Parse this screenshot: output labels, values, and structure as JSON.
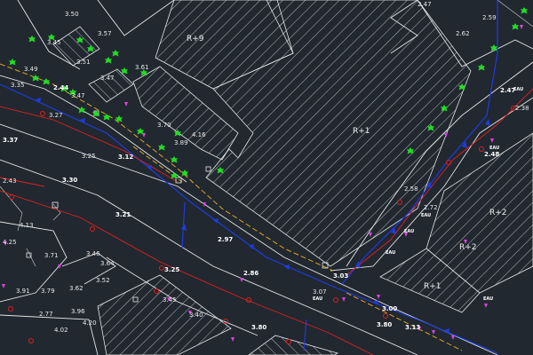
{
  "colors": {
    "background": "#212830",
    "lines": "#e6e6e6",
    "sewer": "#1e3ce0",
    "gas": "#e02020",
    "electric": "#f0b020",
    "tree": "#22dd22",
    "marker": "#e040e0"
  },
  "zones": {
    "r9": "R+9",
    "r1_a": "R+1",
    "r2_a": "R+2",
    "r2_b": "R+2",
    "r1_b": "R+1"
  },
  "eau_labels": [
    "EAU",
    "EAU",
    "EAU",
    "EAU",
    "EAU",
    "EAU",
    "EAU"
  ],
  "elevations": {
    "e350": "3.50",
    "e345": "3.45",
    "e351": "3.51",
    "e357": "3.57",
    "e361": "3.61",
    "e349": "3.49",
    "e335": "3.35",
    "e344": "2.44",
    "e347": "3.47",
    "e347b": "3.47",
    "e327": "3.27",
    "e337": "3.37",
    "e325": "3.25",
    "e312": "3.12",
    "e370": "3.70",
    "e389": "3.89",
    "e416": "4.16",
    "e330": "3.30",
    "e243": "2.43",
    "e321": "3.21",
    "e425": "4.25",
    "e413": "4.13",
    "e297": "2.97",
    "e371": "3.71",
    "e346": "3.46",
    "e364": "3.64",
    "e325b": "3.25",
    "e386": "2.86",
    "e391": "3.91",
    "e379": "3.79",
    "e362": "3.62",
    "e352": "3.52",
    "e345b": "3.45",
    "e340": "3.40",
    "e277": "2.77",
    "e396": "3.96",
    "e420": "4.20",
    "e402": "4.02",
    "e380": "3.80",
    "e307": "3.07",
    "e303": "3.03",
    "e300": "3.00",
    "e380b": "3.80",
    "e313": "3.13",
    "e247": "2.47",
    "e259": "2.59",
    "e262": "2.62",
    "e247b": "2.47",
    "e238": "2.38",
    "e248": "2.48",
    "e258": "2.58",
    "e272": "2.72"
  }
}
